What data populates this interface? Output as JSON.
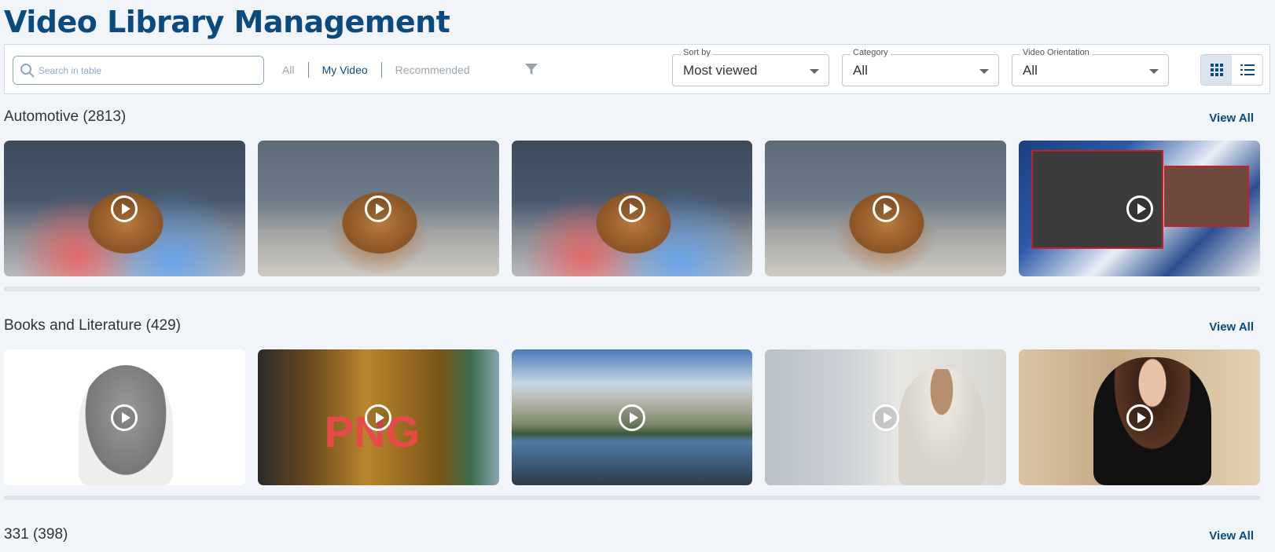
{
  "page_title": "Video Library Management",
  "search": {
    "placeholder": "Search in table"
  },
  "tabs": [
    {
      "label": "All",
      "active": false
    },
    {
      "label": "My Video",
      "active": true
    },
    {
      "label": "Recommended",
      "active": false
    }
  ],
  "filters": {
    "sort_by": {
      "label": "Sort by",
      "value": "Most viewed"
    },
    "category": {
      "label": "Category",
      "value": "All"
    },
    "orientation": {
      "label": "Video Orientation",
      "value": "All"
    }
  },
  "view_mode": "grid",
  "sections": [
    {
      "title": "Automotive (2813)",
      "view_all": "View All",
      "videos": [
        {
          "thumb": "office-dog-dancing"
        },
        {
          "thumb": "office-dog-pipe"
        },
        {
          "thumb": "office-dog-dancing"
        },
        {
          "thumb": "office-dog-pipe"
        },
        {
          "thumb": "news-studio-popcorn"
        }
      ]
    },
    {
      "title": "Books and Literature (429)",
      "view_all": "View All",
      "videos": [
        {
          "thumb": "raccoon-sunglasses"
        },
        {
          "thumb": "coins-png",
          "overlay_text": "PNG"
        },
        {
          "thumb": "mountain-lake"
        },
        {
          "thumb": "girl-praying"
        },
        {
          "thumb": "woman-sunglasses"
        }
      ]
    },
    {
      "title": "331 (398)",
      "view_all": "View All"
    }
  ],
  "colors": {
    "brand": "#0b4a7f",
    "background": "#f1f5f9"
  }
}
